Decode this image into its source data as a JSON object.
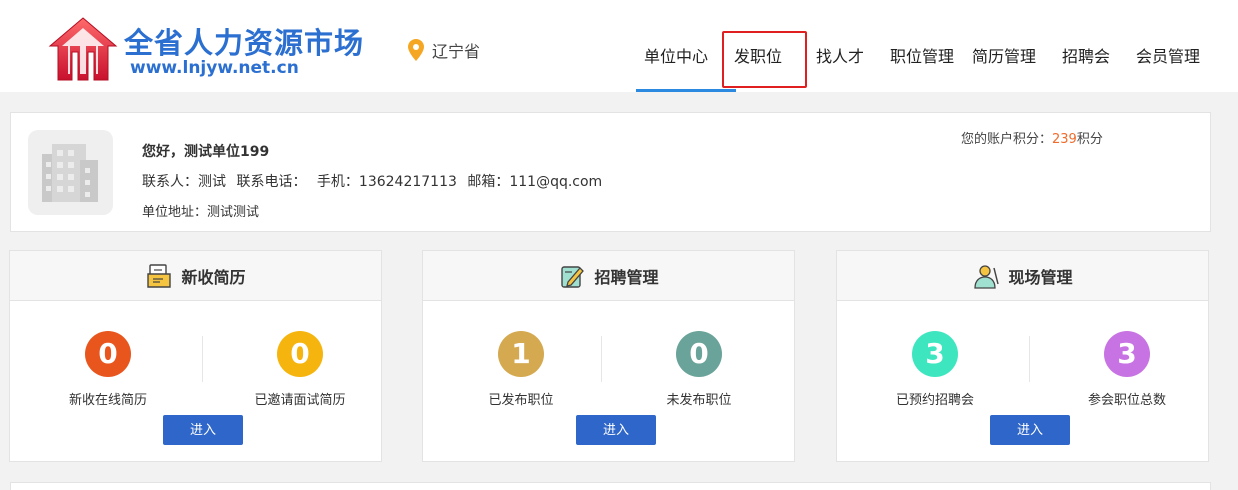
{
  "header": {
    "site_name": "全省人力资源市场",
    "site_url": "www.lnjyw.net.cn",
    "location": "辽宁省",
    "nav": [
      {
        "label": "单位中心",
        "active": true
      },
      {
        "label": "发职位",
        "highlighted": true
      },
      {
        "label": "找人才"
      },
      {
        "label": "职位管理"
      },
      {
        "label": "简历管理"
      },
      {
        "label": "招聘会"
      },
      {
        "label": "会员管理"
      }
    ]
  },
  "profile": {
    "greeting": "您好，测试单位199",
    "contact_person": "联系人：测试",
    "phone": "联系电话：",
    "mobile": "手机：13624217113",
    "email": "邮箱：111@qq.com",
    "address": "单位地址：测试测试",
    "points_prefix": "您的账户积分：",
    "points_value": "239",
    "points_suffix": "积分"
  },
  "cards": [
    {
      "title": "新收简历",
      "icon": "resume-icon",
      "stats": [
        {
          "value": "0",
          "label": "新收在线简历",
          "color": "#e8561e"
        },
        {
          "value": "0",
          "label": "已邀请面试简历",
          "color": "#f5b50e"
        }
      ],
      "button": "进入"
    },
    {
      "title": "招聘管理",
      "icon": "recruit-icon",
      "stats": [
        {
          "value": "1",
          "label": "已发布职位",
          "color": "#d4a94f"
        },
        {
          "value": "0",
          "label": "未发布职位",
          "color": "#6aa39a"
        }
      ],
      "button": "进入"
    },
    {
      "title": "现场管理",
      "icon": "onsite-icon",
      "stats": [
        {
          "value": "3",
          "label": "已预约招聘会",
          "color": "#3ee6c0"
        },
        {
          "value": "3",
          "label": "参会职位总数",
          "color": "#c873e3"
        }
      ],
      "button": "进入"
    }
  ],
  "colors": {
    "brand": "#2b6fd1",
    "accent_points": "#f26b2a",
    "button": "#2f66c9",
    "nav_underline": "#2b8ae0",
    "highlight": "#e02020"
  }
}
